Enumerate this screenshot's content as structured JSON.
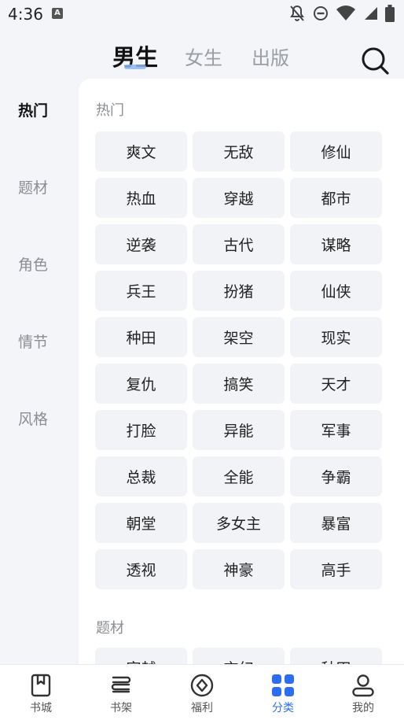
{
  "status_bar": {
    "time": "4:36",
    "app_badge": "A"
  },
  "header": {
    "tabs": [
      {
        "label": "男生",
        "active": true
      },
      {
        "label": "女生",
        "active": false
      },
      {
        "label": "出版",
        "active": false
      }
    ]
  },
  "sidebar": {
    "items": [
      {
        "label": "热门",
        "active": true
      },
      {
        "label": "题材",
        "active": false
      },
      {
        "label": "角色",
        "active": false
      },
      {
        "label": "情节",
        "active": false
      },
      {
        "label": "风格",
        "active": false
      }
    ]
  },
  "sections": [
    {
      "title": "热门",
      "tags": [
        "爽文",
        "无敌",
        "修仙",
        "热血",
        "穿越",
        "都市",
        "逆袭",
        "古代",
        "谋略",
        "兵王",
        "扮猪",
        "仙侠",
        "种田",
        "架空",
        "现实",
        "复仇",
        "搞笑",
        "天才",
        "打脸",
        "异能",
        "军事",
        "总裁",
        "全能",
        "争霸",
        "朝堂",
        "多女主",
        "暴富",
        "透视",
        "神豪",
        "高手"
      ]
    },
    {
      "title": "题材",
      "tags": [
        "穿越",
        "玄幻",
        "种田"
      ]
    }
  ],
  "bottom_nav": {
    "items": [
      {
        "label": "书城",
        "icon": "bookmark-book-icon",
        "active": false
      },
      {
        "label": "书架",
        "icon": "bookshelf-icon",
        "active": false
      },
      {
        "label": "福利",
        "icon": "diamond-coin-icon",
        "active": false
      },
      {
        "label": "分类",
        "icon": "grid-category-icon",
        "active": true
      },
      {
        "label": "我的",
        "icon": "profile-icon",
        "active": false
      }
    ]
  },
  "colors": {
    "accent": "#2b6ff0",
    "background": "#f3f5f9",
    "chip": "#f1f3f6",
    "text": "#222222",
    "muted": "#8a8d93"
  }
}
